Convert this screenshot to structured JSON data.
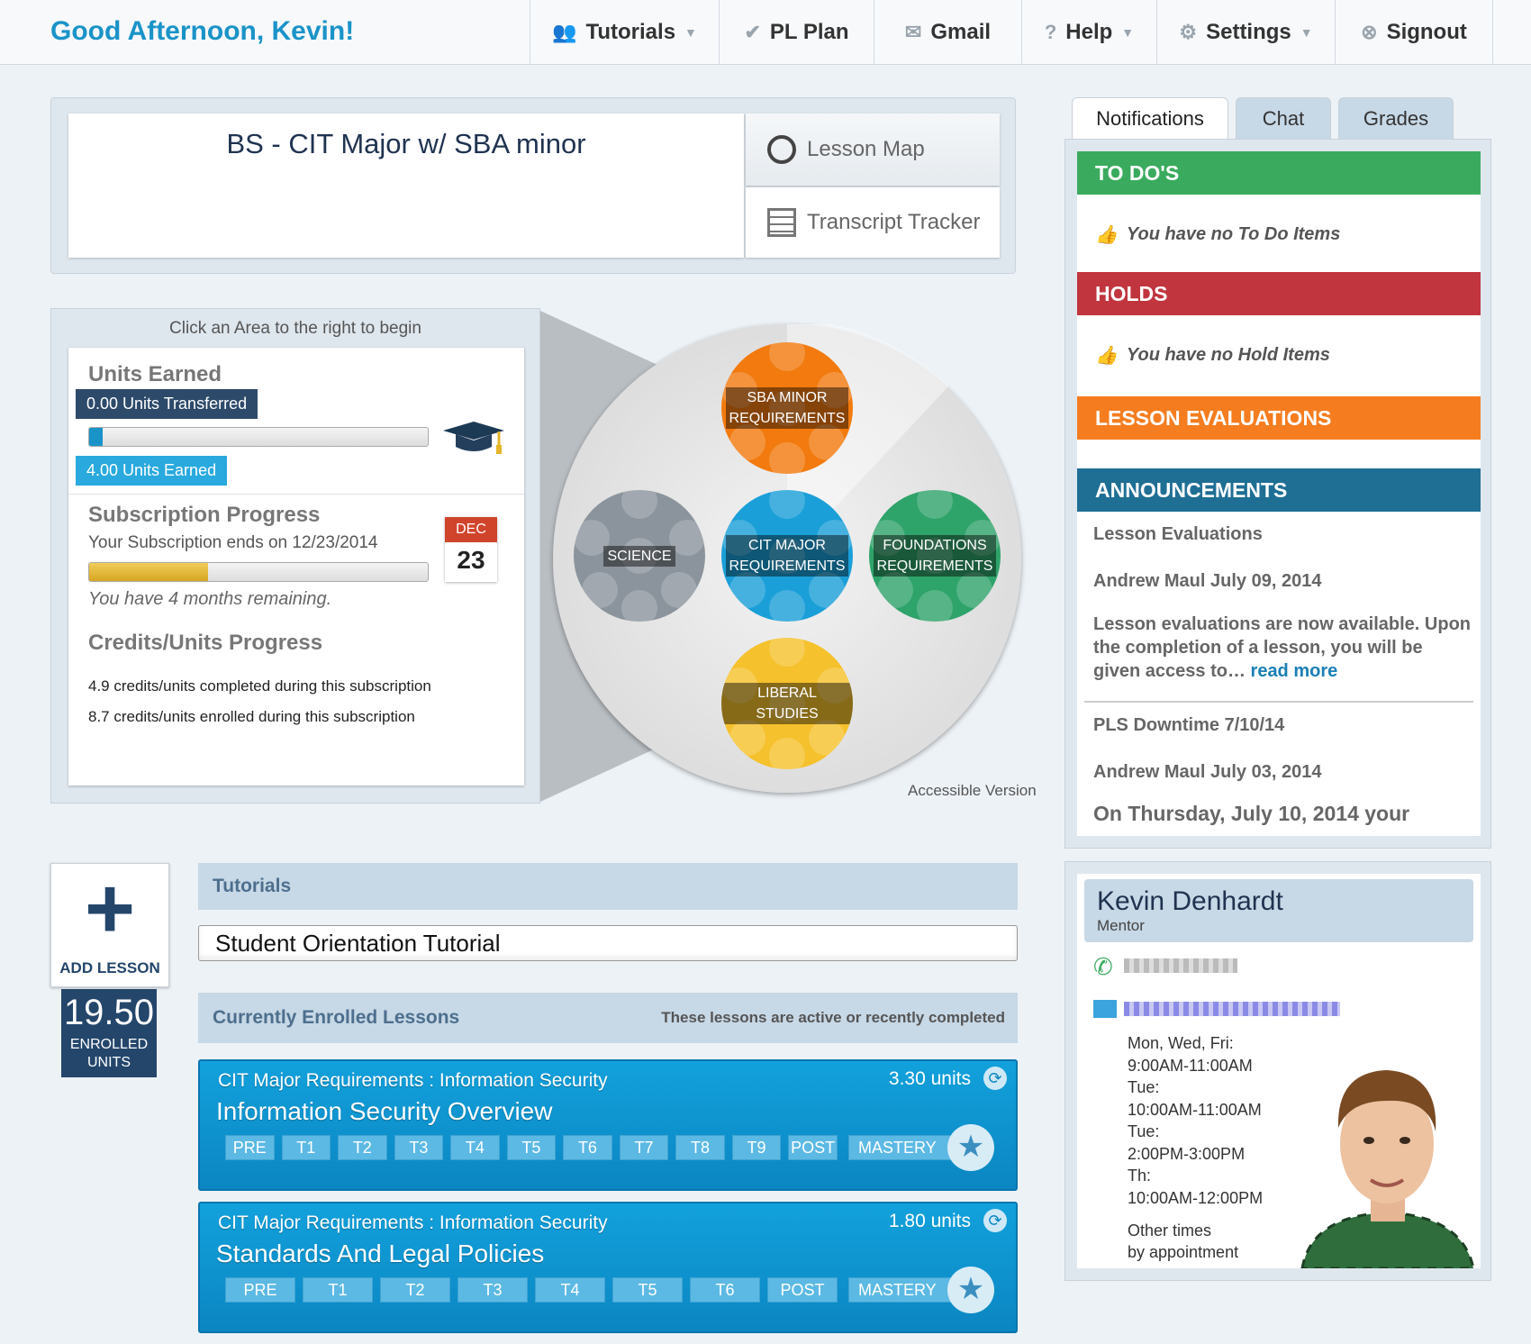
{
  "header": {
    "greeting": "Good Afternoon, Kevin!",
    "nav": [
      {
        "label": "Tutorials",
        "icon": "people-icon",
        "caret": true
      },
      {
        "label": "PL Plan",
        "icon": "check-icon",
        "caret": false
      },
      {
        "label": "Gmail",
        "icon": "mail-icon",
        "caret": false
      },
      {
        "label": "Help",
        "icon": "question-icon",
        "caret": true
      },
      {
        "label": "Settings",
        "icon": "gear-icon",
        "caret": true
      },
      {
        "label": "Signout",
        "icon": "close-circle-icon",
        "caret": false
      }
    ]
  },
  "program": {
    "title": "BS - CIT Major w/ SBA minor",
    "lesson_map": "Lesson Map",
    "transcript_tracker": "Transcript Tracker"
  },
  "progress": {
    "hint": "Click an Area to the right to begin",
    "units_title": "Units Earned",
    "units_transferred": "0.00 Units Transferred",
    "units_earned": "4.00 Units Earned",
    "units_bar_fraction": 0.04,
    "subscription_title": "Subscription Progress",
    "subscription_end": "Your Subscription ends on 12/23/2014",
    "subscription_bar_fraction": 0.35,
    "months_remaining": "You have 4 months remaining.",
    "calendar_month": "DEC",
    "calendar_day": "23",
    "credits_title": "Credits/Units Progress",
    "credits_completed": "4.9 credits/units completed during this subscription",
    "credits_enrolled": "8.7 credits/units enrolled during this subscription"
  },
  "areas": {
    "sba": "SBA MINOR\nREQUIREMENTS",
    "science": "SCIENCE",
    "cit": "CIT MAJOR\nREQUIREMENTS",
    "foundations": "FOUNDATIONS\nREQUIREMENTS",
    "liberal": "LIBERAL STUDIES",
    "accessible": "Accessible Version"
  },
  "add_lesson": {
    "label": "ADD LESSON",
    "units_value": "19.50",
    "units_label_1": "ENROLLED",
    "units_label_2": "UNITS"
  },
  "tutorials": {
    "heading": "Tutorials",
    "item": "Student Orientation Tutorial"
  },
  "enrolled": {
    "heading": "Currently Enrolled Lessons",
    "note": "These lessons are active or recently completed",
    "lessons": [
      {
        "subtitle": "CIT Major Requirements : Information Security",
        "units": "3.30 units",
        "title": "Information Security Overview",
        "steps": [
          "PRE",
          "T1",
          "T2",
          "T3",
          "T4",
          "T5",
          "T6",
          "T7",
          "T8",
          "T9",
          "POST"
        ],
        "mastery": "MASTERY"
      },
      {
        "subtitle": "CIT Major Requirements : Information Security",
        "units": "1.80 units",
        "title": "Standards And Legal Policies",
        "steps": [
          "PRE",
          "T1",
          "T2",
          "T3",
          "T4",
          "T5",
          "T6",
          "POST"
        ],
        "mastery": "MASTERY"
      }
    ]
  },
  "tabs": [
    "Notifications",
    "Chat",
    "Grades"
  ],
  "notifications": {
    "todo_title": "TO DO'S",
    "todo_empty": "You have no To Do Items",
    "holds_title": "HOLDS",
    "holds_empty": "You have no Hold Items",
    "eval_title": "LESSON EVALUATIONS",
    "ann_title": "ANNOUNCEMENTS",
    "ann1_title": "Lesson Evaluations",
    "ann1_meta": "Andrew Maul July 09, 2014",
    "ann1_body": "Lesson evaluations are now available. Upon the completion of a lesson, you will be given access to…",
    "ann1_more": "read more",
    "ann2_title": "PLS Downtime 7/10/14",
    "ann2_meta": "Andrew Maul July 03, 2014",
    "ann2_body": "On Thursday, July 10, 2014 your"
  },
  "mentor": {
    "name": "Kevin Denhardt",
    "role": "Mentor",
    "hours": [
      "Mon, Wed, Fri:",
      "9:00AM-11:00AM",
      "Tue:",
      "10:00AM-11:00AM",
      "Tue:",
      "2:00PM-3:00PM",
      "Th:",
      "10:00AM-12:00PM"
    ],
    "other1": "Other times",
    "other2": "by appointment"
  },
  "colors": {
    "accent": "#1a93c8",
    "todo": "#3aab5e",
    "holds": "#c0353e",
    "eval": "#f57d20",
    "announce": "#1f6f95",
    "sba": "#f27a0e",
    "science": "#8b949c",
    "cit": "#1a9fd8",
    "foundations": "#2ea36a",
    "liberal": "#f5c12c"
  }
}
